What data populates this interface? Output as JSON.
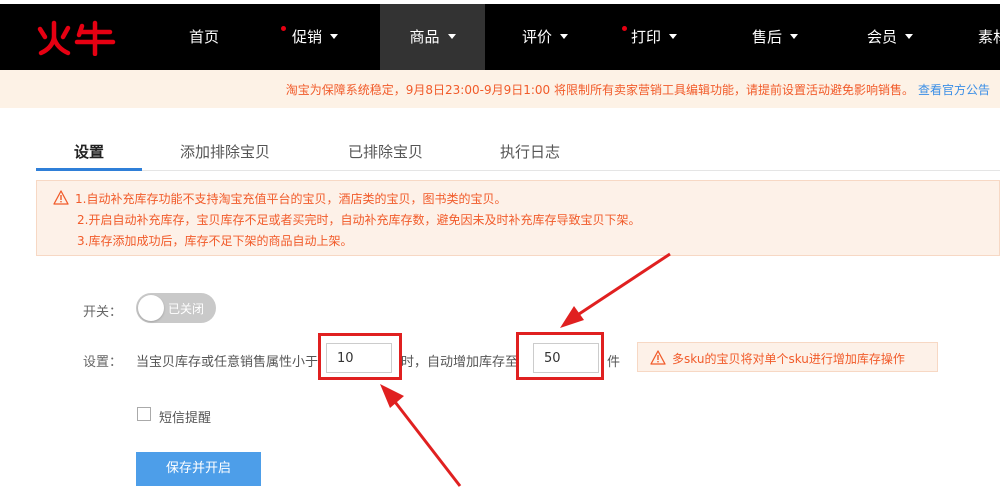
{
  "nav": {
    "brand": "火牛",
    "items": [
      {
        "label": "首页",
        "has_dot": false,
        "has_caret": false
      },
      {
        "label": "促销",
        "has_dot": true,
        "has_caret": true
      },
      {
        "label": "商品",
        "has_dot": false,
        "has_caret": true,
        "active": true
      },
      {
        "label": "评价",
        "has_dot": false,
        "has_caret": true
      },
      {
        "label": "打印",
        "has_dot": true,
        "has_caret": true
      },
      {
        "label": "售后",
        "has_dot": false,
        "has_caret": true
      },
      {
        "label": "会员",
        "has_dot": false,
        "has_caret": true
      },
      {
        "label": "素材",
        "has_dot": false,
        "has_caret": false
      }
    ]
  },
  "notice": {
    "text": "淘宝为保障系统稳定，9月8日23:00-9月9日1:00 将限制所有卖家营销工具编辑功能，请提前设置活动避免影响销售。",
    "link": "查看官方公告"
  },
  "tabs": [
    {
      "label": "设置",
      "active": true
    },
    {
      "label": "添加排除宝贝"
    },
    {
      "label": "已排除宝贝"
    },
    {
      "label": "执行日志"
    }
  ],
  "warning": {
    "lines": [
      "1.自动补充库存功能不支持淘宝充值平台的宝贝，酒店类的宝贝，图书类的宝贝。",
      "2.开启自动补充库存，宝贝库存不足或者买完时，自动补充库存数，避免因未及时补充库存导致宝贝下架。",
      "3.库存添加成功后，库存不足下架的商品自动上架。"
    ]
  },
  "form": {
    "switch_label": "开关：",
    "switch_state": "已关闭",
    "settings_label": "设置：",
    "condition_text": "当宝贝库存或任意销售属性小于",
    "threshold_value": "10",
    "mid_text": "时，自动增加库存至",
    "stock_value": "50",
    "unit": "件",
    "sku_tip": "多sku的宝贝将对单个sku进行增加库存操作",
    "sms_label": "短信提醒",
    "submit_label": "保存并开启"
  },
  "colors": {
    "nav_bg": "#000000",
    "accent_red": "#e60012",
    "warning_orange": "#f15b2a",
    "link_blue": "#3a8ee6",
    "primary_button": "#4d9ee9",
    "annotation_red": "#e02020"
  }
}
